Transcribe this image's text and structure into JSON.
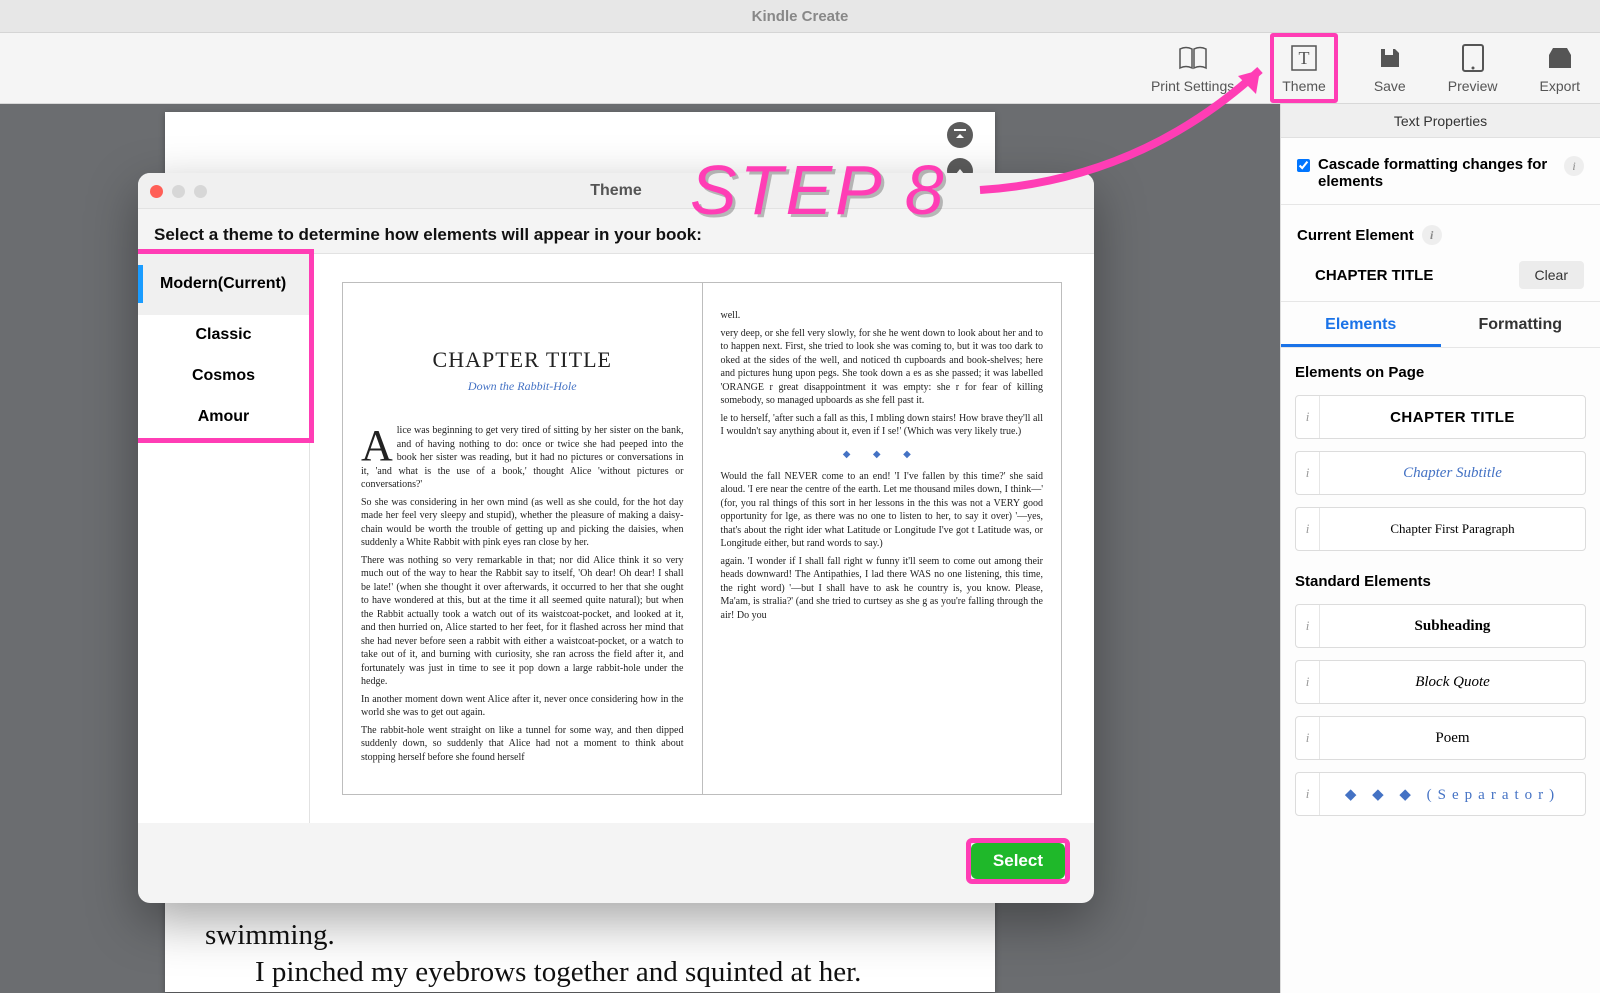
{
  "app": {
    "title": "Kindle Create"
  },
  "toolbar": {
    "print_settings": "Print Settings",
    "theme": "Theme",
    "save": "Save",
    "preview": "Preview",
    "export": "Export"
  },
  "panel": {
    "title": "Text Properties",
    "cascade_label": "Cascade formatting changes for elements",
    "current_element_label": "Current Element",
    "current_element_value": "CHAPTER TITLE",
    "clear": "Clear",
    "tabs": {
      "elements": "Elements",
      "formatting": "Formatting"
    },
    "elements_on_page": "Elements on Page",
    "page_elements": {
      "chapter_title": "CHAPTER TITLE",
      "chapter_subtitle": "Chapter Subtitle",
      "first_para": "Chapter First Paragraph"
    },
    "standard_elements_label": "Standard Elements",
    "standard_elements": {
      "subheading": "Subheading",
      "block_quote": "Block Quote",
      "poem": "Poem",
      "separator": "◆  ◆  ◆  (Separator)"
    }
  },
  "visible_doc": {
    "line1": "swimming.",
    "line2": "I pinched my eyebrows together and squinted at her."
  },
  "modal": {
    "title": "Theme",
    "instruction": "Select a theme to determine how elements will appear in your book:",
    "themes": [
      "Modern(Current)",
      "Classic",
      "Cosmos",
      "Amour"
    ],
    "select_button": "Select",
    "preview": {
      "chapter_title": "CHAPTER TITLE",
      "chapter_subtitle": "Down the Rabbit-Hole",
      "left_paragraphs": [
        "lice was beginning to get very tired of sitting by her sister on the bank, and of having nothing to do: once or twice she had peeped into the book her sister was reading, but it had no pictures or conversations in it, 'and what is the use of a book,' thought Alice 'without pictures or conversations?'",
        "So she was considering in her own mind (as well as she could, for the hot day made her feel very sleepy and stupid), whether the pleasure of making a daisy-chain would be worth the trouble of getting up and picking the daisies, when suddenly a White Rabbit with pink eyes ran close by her.",
        "There was nothing so very remarkable in that; nor did Alice think it so very much out of the way to hear the Rabbit say to itself, 'Oh dear! Oh dear! I shall be late!' (when she thought it over afterwards, it occurred to her that she ought to have wondered at this, but at the time it all seemed quite natural); but when the Rabbit actually took a watch out of its waistcoat-pocket, and looked at it, and then hurried on, Alice started to her feet, for it flashed across her mind that she had never before seen a rabbit with either a waistcoat-pocket, or a watch to take out of it, and burning with curiosity, she ran across the field after it, and fortunately was just in time to see it pop down a large rabbit-hole under the hedge.",
        "In another moment down went Alice after it, never once considering how in the world she was to get out again.",
        "The rabbit-hole went straight on like a tunnel for some way, and then dipped suddenly down, so suddenly that Alice had not a moment to think about stopping herself before she found herself"
      ],
      "right_paragraphs_top": [
        "well.",
        "very deep, or she fell very slowly, for she he went down to look about her and to to happen next. First, she tried to look she was coming to, but it was too dark to oked at the sides of the well, and noticed th cupboards and book-shelves; here and pictures hung upon pegs. She took down a es as she passed; it was labelled 'ORANGE r great disappointment it was empty: she r for fear of killing somebody, so managed upboards as she fell past it.",
        "le to herself, 'after such a fall as this, I mbling down stairs! How brave they'll all I wouldn't say anything about it, even if I se!' (Which was very likely true.)"
      ],
      "separator": "◆   ◆   ◆",
      "right_paragraphs_bottom": [
        "Would the fall NEVER come to an end! 'I I've fallen by this time?' she said aloud. 'I ere near the centre of the earth. Let me thousand miles down, I think—' (for, you ral things of this sort in her lessons in the this was not a VERY good opportunity for lge, as there was no one to listen to her, to say it over) '—yes, that's about the right ider what Latitude or Longitude I've got t Latitude was, or Longitude either, but rand words to say.)",
        "again. 'I wonder if I shall fall right w funny it'll seem to come out among their heads downward! The Antipathies, I lad there WAS no one listening, this time, the right word) '—but I shall have to ask he country is, you know. Please, Ma'am, is stralia?' (and she tried to curtsey as she g as you're falling through the air! Do you"
      ]
    }
  },
  "annotation": {
    "step_label": "STEP 8"
  }
}
